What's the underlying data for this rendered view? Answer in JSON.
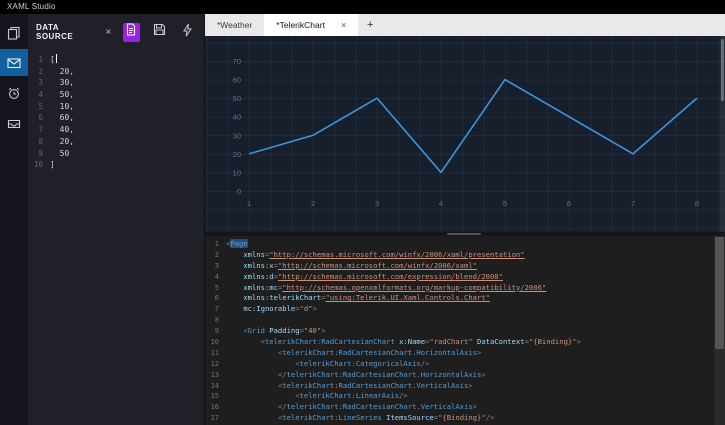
{
  "app": {
    "title": "XAML Studio"
  },
  "activity_bar": {
    "items": [
      {
        "name": "copy-pages",
        "active": false
      },
      {
        "name": "data-source-mail",
        "active": true
      },
      {
        "name": "alarm-clock",
        "active": false
      },
      {
        "name": "inbox-tray",
        "active": false
      }
    ]
  },
  "data_source": {
    "title": "DATA SOURCE",
    "close_label": "×",
    "lines": [
      {
        "n": "1",
        "t": "[",
        "caret": true
      },
      {
        "n": "2",
        "t": "  20,"
      },
      {
        "n": "3",
        "t": "  30,"
      },
      {
        "n": "4",
        "t": "  50,"
      },
      {
        "n": "5",
        "t": "  10,"
      },
      {
        "n": "6",
        "t": "  60,"
      },
      {
        "n": "7",
        "t": "  40,"
      },
      {
        "n": "8",
        "t": "  20,"
      },
      {
        "n": "9",
        "t": "  50"
      },
      {
        "n": "10",
        "t": "]"
      }
    ]
  },
  "tab_bar": {
    "tabs": [
      {
        "label": "*Weather",
        "active": false
      },
      {
        "label": "*TelerikChart",
        "active": true,
        "close_label": "×"
      }
    ],
    "new_tab_label": "+"
  },
  "chart_data": {
    "type": "line",
    "x": [
      1,
      2,
      3,
      4,
      5,
      6,
      7,
      8
    ],
    "values": [
      20,
      30,
      50,
      10,
      60,
      40,
      20,
      50
    ],
    "xticks": [
      "1",
      "2",
      "3",
      "4",
      "5",
      "6",
      "7",
      "8"
    ],
    "yticks": [
      70,
      60,
      50,
      40,
      30,
      20,
      10,
      0
    ],
    "ylim": [
      0,
      70
    ],
    "title": "",
    "xlabel": "",
    "ylabel": "",
    "grid": true,
    "legend": false,
    "line_color": "#3a96dd",
    "axis_label_color": "#5f7187"
  },
  "code_editor": {
    "lines": [
      {
        "n": "1",
        "toks": [
          [
            "p",
            "<"
          ],
          [
            "tag",
            "Page",
            "sel"
          ]
        ]
      },
      {
        "n": "2",
        "toks": [
          [
            "ws",
            "    "
          ],
          [
            "attr",
            "xmlns"
          ],
          [
            "p",
            "="
          ],
          [
            "link",
            "\"http://schemas.microsoft.com/winfx/2006/xaml/presentation\""
          ]
        ]
      },
      {
        "n": "3",
        "toks": [
          [
            "ws",
            "    "
          ],
          [
            "attr",
            "xmlns:x"
          ],
          [
            "p",
            "="
          ],
          [
            "link",
            "\"http://schemas.microsoft.com/winfx/2006/xaml\""
          ]
        ]
      },
      {
        "n": "4",
        "toks": [
          [
            "ws",
            "    "
          ],
          [
            "attr",
            "xmlns:d"
          ],
          [
            "p",
            "="
          ],
          [
            "link",
            "\"http://schemas.microsoft.com/expression/blend/2008\""
          ]
        ]
      },
      {
        "n": "5",
        "toks": [
          [
            "ws",
            "    "
          ],
          [
            "attr",
            "xmlns:mc"
          ],
          [
            "p",
            "="
          ],
          [
            "link",
            "\"http://schemas.openxmlformats.org/markup-compatibility/2006\""
          ]
        ]
      },
      {
        "n": "6",
        "toks": [
          [
            "ws",
            "    "
          ],
          [
            "attr",
            "xmlns:telerikChart"
          ],
          [
            "p",
            "="
          ],
          [
            "link",
            "\"using:Telerik.UI.Xaml.Controls.Chart\""
          ]
        ]
      },
      {
        "n": "7",
        "toks": [
          [
            "ws",
            "    "
          ],
          [
            "attr",
            "mc:Ignorable"
          ],
          [
            "p",
            "="
          ],
          [
            "str",
            "\"d\""
          ],
          [
            "p",
            ">"
          ]
        ]
      },
      {
        "n": "8",
        "toks": []
      },
      {
        "n": "9",
        "toks": [
          [
            "ws",
            "    "
          ],
          [
            "p",
            "<"
          ],
          [
            "tag",
            "Grid"
          ],
          [
            "ws",
            " "
          ],
          [
            "attr",
            "Padding"
          ],
          [
            "p",
            "="
          ],
          [
            "str",
            "\"40\""
          ],
          [
            "p",
            ">"
          ]
        ]
      },
      {
        "n": "10",
        "toks": [
          [
            "ws",
            "        "
          ],
          [
            "p",
            "<"
          ],
          [
            "tag",
            "telerikChart:RadCartesianChart"
          ],
          [
            "ws",
            " "
          ],
          [
            "attr",
            "x:Name"
          ],
          [
            "p",
            "="
          ],
          [
            "str",
            "\"radChart\""
          ],
          [
            "ws",
            " "
          ],
          [
            "attr",
            "DataContext"
          ],
          [
            "p",
            "="
          ],
          [
            "str",
            "\"{Binding}\""
          ],
          [
            "p",
            ">"
          ]
        ]
      },
      {
        "n": "11",
        "toks": [
          [
            "ws",
            "            "
          ],
          [
            "p",
            "<"
          ],
          [
            "tag",
            "telerikChart:RadCartesianChart.HorizontalAxis"
          ],
          [
            "p",
            ">"
          ]
        ]
      },
      {
        "n": "12",
        "toks": [
          [
            "ws",
            "                "
          ],
          [
            "p",
            "<"
          ],
          [
            "tag",
            "telerikChart:CategoricalAxis"
          ],
          [
            "p",
            "/>"
          ]
        ]
      },
      {
        "n": "13",
        "toks": [
          [
            "ws",
            "            "
          ],
          [
            "p",
            "</"
          ],
          [
            "tag",
            "telerikChart:RadCartesianChart.HorizontalAxis"
          ],
          [
            "p",
            ">"
          ]
        ]
      },
      {
        "n": "14",
        "toks": [
          [
            "ws",
            "            "
          ],
          [
            "p",
            "<"
          ],
          [
            "tag",
            "telerikChart:RadCartesianChart.VerticalAxis"
          ],
          [
            "p",
            ">"
          ]
        ]
      },
      {
        "n": "15",
        "toks": [
          [
            "ws",
            "                "
          ],
          [
            "p",
            "<"
          ],
          [
            "tag",
            "telerikChart:LinearAxis"
          ],
          [
            "p",
            "/>"
          ]
        ]
      },
      {
        "n": "16",
        "toks": [
          [
            "ws",
            "            "
          ],
          [
            "p",
            "</"
          ],
          [
            "tag",
            "telerikChart:RadCartesianChart.VerticalAxis"
          ],
          [
            "p",
            ">"
          ]
        ]
      },
      {
        "n": "17",
        "toks": [
          [
            "ws",
            "            "
          ],
          [
            "p",
            "<"
          ],
          [
            "tag",
            "telerikChart:LineSeries"
          ],
          [
            "ws",
            " "
          ],
          [
            "attr",
            "ItemsSource"
          ],
          [
            "p",
            "="
          ],
          [
            "str",
            "\"{Binding}\""
          ],
          [
            "p",
            "/>"
          ]
        ]
      }
    ]
  },
  "colors": {
    "accent_line": "#3a96dd",
    "purple_button": "#9c1fe8",
    "active_icon_bg": "#11609e",
    "preview_bg": "#161f2b"
  }
}
